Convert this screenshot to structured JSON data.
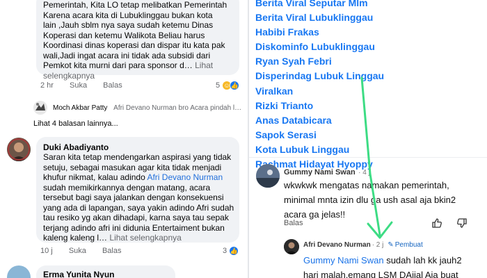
{
  "left": {
    "comment1": {
      "lines": [
        "Pemerintah, Kita LO tetap melibatkan Pemerintah",
        "Karena acara kita di Lubuklinggau bukan kota",
        "lain ,Jauh sblm nya saya sudah ketemu Dinas",
        "Koperasi dan ketemu Walikota Beliau harus",
        "Koordinasi dinas koperasi dan dispar itu kata pak",
        "wali,Jadi ingat acara ini tidak ada subsidi dari",
        "Pemkot kita murni dari para sponsor d…"
      ],
      "see_more_a": "Lihat",
      "see_more_b": "selengkapnya",
      "time": "2 hr",
      "like": "Suka",
      "reply": "Balas",
      "reaction_count": "5"
    },
    "reply_preview": {
      "author": "Moch Akbar Patty",
      "text": "Afri Devano Nurman bro Acara pindah l…"
    },
    "view_more_replies": "Lihat 4 balasan lainnya...",
    "comment2": {
      "author": "Duki Abadiyanto",
      "line1": "Saran kita tetap mendengarkan aspirasi yang tidak",
      "line2": "setuju, sebagai masukan agar kita tidak menjadi",
      "line3": "khufur nikmat, kalau adindo",
      "mention": "Afri Devano Nurman",
      "lines_rest": [
        "sudah memikirkannya dengan matang, acara",
        "tersebut bagi saya jalankan dengan konsekuensi",
        "yang ada di lapangan, saya yakin adindo Afri sudah",
        "tau resiko yg akan dihadapi, karna saya tau sepak",
        "terjang adindo afri ini didunia Entertaiment bukan"
      ],
      "last_line": "kaleng kaleng l…",
      "see_more": "Lihat selengkapnya",
      "time": "10 j",
      "like": "Suka",
      "reply": "Balas",
      "reaction_count": "3"
    },
    "comment3": {
      "author": "Erma Yunita Nyun"
    }
  },
  "right": {
    "tags": [
      "Berita Viral Seputar Mlm",
      "Berita Viral Lubuklinggau",
      "Habibi Frakas",
      "Diskominfo Lubuklinggau",
      "Ryan Syah Febri",
      "Disperindag Lubuk Linggau",
      "Viralkan",
      "Rizki Trianto",
      "Anas Databicara",
      "Sapok Serasi",
      "Kota Lubuk Linggau",
      "Rachmat Hidayat Hyoppy"
    ],
    "comment": {
      "author": "Gummy Nami Swan",
      "time": "· 4 j",
      "lines": [
        "wkwkwk mengatas namakan pemerintah,",
        "minimal mnta izin dlu ga ush asal aja bkin2",
        "acara ga jelas!!"
      ],
      "reply": "Balas"
    },
    "reply": {
      "author": "Afri Devano Nurman",
      "time": "· 2 j",
      "badge": "Pembuat",
      "mention": "Gummy Nami Swan",
      "line1_rest": " sudah lah kk jauh2",
      "line2": "hari malah,emang LSM DAjjal Aja buat"
    }
  },
  "colors": {
    "mention": "#216fdb",
    "tag": "#1877f2",
    "arrow": "#3ddc84",
    "bubble": "#f0f2f5",
    "like_blue": "#1877f2",
    "haha_yellow": "#f7b928"
  }
}
